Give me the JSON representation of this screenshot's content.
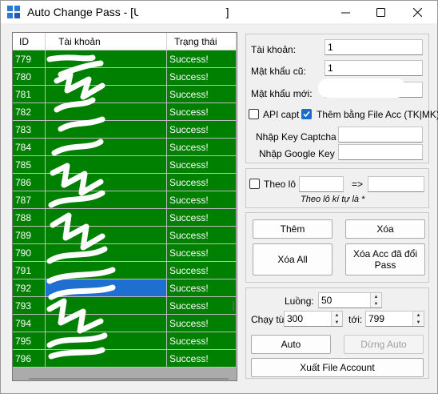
{
  "window": {
    "title": "Auto Change Pass - [User",
    "title_suffix": "]",
    "controls": [
      "minimize-icon",
      "maximize-icon",
      "close-icon"
    ]
  },
  "grid": {
    "columns": [
      "ID",
      "Tài khoản",
      "Trạng thái"
    ],
    "rows": [
      {
        "id": "779",
        "status": "Success!"
      },
      {
        "id": "780",
        "status": "Success!"
      },
      {
        "id": "781",
        "status": "Success!"
      },
      {
        "id": "782",
        "status": "Success!"
      },
      {
        "id": "783",
        "status": "Success!"
      },
      {
        "id": "784",
        "status": "Success!"
      },
      {
        "id": "785",
        "status": "Success!"
      },
      {
        "id": "786",
        "status": "Success!"
      },
      {
        "id": "787",
        "status": "Success!"
      },
      {
        "id": "788",
        "status": "Success!"
      },
      {
        "id": "789",
        "status": "Success!"
      },
      {
        "id": "790",
        "status": "Success!"
      },
      {
        "id": "791",
        "status": "Success!"
      },
      {
        "id": "792",
        "status": "Success!",
        "selected": true
      },
      {
        "id": "793",
        "status": "Success!"
      },
      {
        "id": "794",
        "status": "Success!"
      },
      {
        "id": "795",
        "status": "Success!"
      },
      {
        "id": "796",
        "status": "Success!"
      }
    ],
    "row_color": "#008000",
    "selected_color": "#1f6fd0"
  },
  "form": {
    "account_label": "Tài khoản:",
    "account_value": "1",
    "old_pass_label": "Mật khẩu cũ:",
    "old_pass_value": "1",
    "new_pass_label": "Mật khẩu mới:",
    "new_pass_value": "",
    "api_captcha_label": "API capt",
    "api_captcha_checked": false,
    "add_by_file_label": "Thêm bằng File Acc (TK|MK)",
    "add_by_file_checked": true,
    "captcha_key_label": "Nhập Key Captcha",
    "captcha_key_value": "",
    "google_key_label": "Nhập Google Key",
    "google_key_value": ""
  },
  "batch": {
    "label": "Theo lô",
    "checked": false,
    "from_value": "",
    "arrow": "=>",
    "to_value": "",
    "hint": "Theo lô kí tự là *"
  },
  "actions": {
    "add": "Thêm",
    "delete": "Xóa",
    "delete_all": "Xóa All",
    "delete_changed": "Xóa Acc đã đổi Pass"
  },
  "run": {
    "threads_label": "Luồng:",
    "threads_value": "50",
    "from_label": "Chạy từ:",
    "from_value": "300",
    "to_label": "tới:",
    "to_value": "799",
    "auto": "Auto",
    "stop_auto": "Dừng Auto",
    "export": "Xuất File Account"
  }
}
